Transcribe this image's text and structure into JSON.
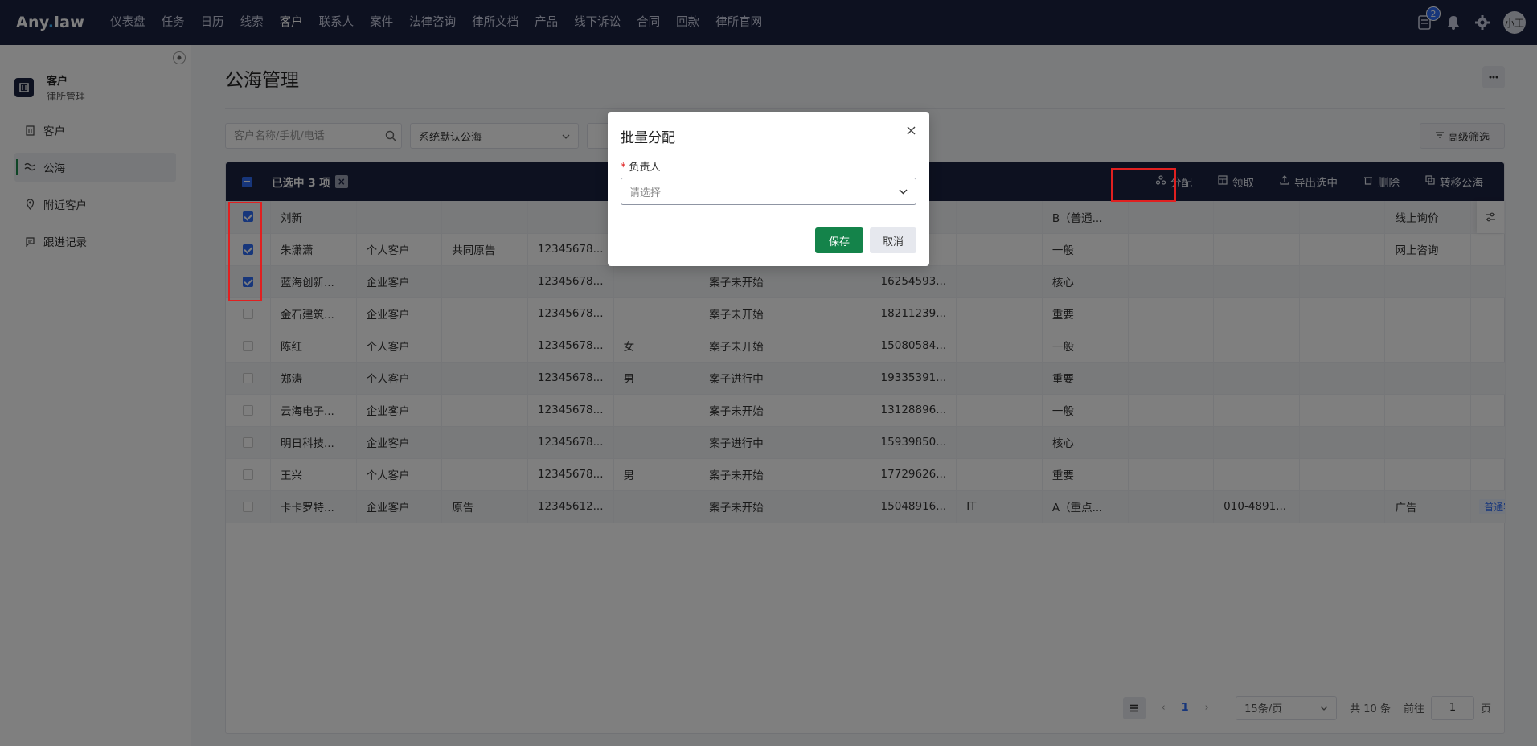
{
  "app": {
    "logo_main": "Any",
    "logo_dot": ".",
    "logo_suffix": "law",
    "nav": [
      "仪表盘",
      "任务",
      "日历",
      "线索",
      "客户",
      "联系人",
      "案件",
      "法律咨询",
      "律所文档",
      "产品",
      "线下诉讼",
      "合同",
      "回款",
      "律所官网"
    ],
    "active_nav": "客户",
    "notification_count": "2",
    "avatar_text": "小王"
  },
  "sidebar": {
    "title": "客户",
    "subtitle": "律所管理",
    "items": [
      {
        "label": "客户",
        "icon": "building-icon"
      },
      {
        "label": "公海",
        "icon": "waves-icon",
        "active": true
      },
      {
        "label": "附近客户",
        "icon": "map-pin-icon"
      },
      {
        "label": "跟进记录",
        "icon": "chat-icon"
      }
    ]
  },
  "page": {
    "title": "公海管理",
    "search_placeholder": "客户名称/手机/电话",
    "pool_select": "系统默认公海",
    "advanced_filter": "高级筛选"
  },
  "batch": {
    "selected_text": "已选中 3 项",
    "actions": [
      {
        "label": "分配",
        "icon": "users-icon"
      },
      {
        "label": "领取",
        "icon": "grid-icon"
      },
      {
        "label": "导出选中",
        "icon": "upload-icon"
      },
      {
        "label": "删除",
        "icon": "trash-icon"
      },
      {
        "label": "转移公海",
        "icon": "copy-icon"
      }
    ]
  },
  "table": {
    "rows": [
      {
        "checked": true,
        "cells": [
          "刘新",
          "",
          "",
          "",
          "",
          "",
          "",
          "",
          "",
          "B（普通...",
          "",
          "",
          "",
          "线上询价",
          ""
        ]
      },
      {
        "checked": true,
        "cells": [
          "朱潇潇",
          "个人客户",
          "共同原告",
          "12345678...",
          "",
          "",
          "",
          "",
          "",
          "一般",
          "",
          "",
          "",
          "网上咨询",
          ""
        ]
      },
      {
        "checked": true,
        "cells": [
          "蓝海创新...",
          "企业客户",
          "",
          "12345678...",
          "",
          "案子未开始",
          "",
          "16254593...",
          "",
          "核心",
          "",
          "",
          "",
          "",
          ""
        ]
      },
      {
        "checked": false,
        "cells": [
          "金石建筑...",
          "企业客户",
          "",
          "12345678...",
          "",
          "案子未开始",
          "",
          "18211239...",
          "",
          "重要",
          "",
          "",
          "",
          "",
          ""
        ]
      },
      {
        "checked": false,
        "cells": [
          "陈红",
          "个人客户",
          "",
          "12345678...",
          "女",
          "案子未开始",
          "",
          "15080584...",
          "",
          "一般",
          "",
          "",
          "",
          "",
          ""
        ]
      },
      {
        "checked": false,
        "cells": [
          "郑涛",
          "个人客户",
          "",
          "12345678...",
          "男",
          "案子进行中",
          "",
          "19335391...",
          "",
          "重要",
          "",
          "",
          "",
          "",
          ""
        ]
      },
      {
        "checked": false,
        "cells": [
          "云海电子...",
          "企业客户",
          "",
          "12345678...",
          "",
          "案子未开始",
          "",
          "13128896...",
          "",
          "一般",
          "",
          "",
          "",
          "",
          ""
        ]
      },
      {
        "checked": false,
        "cells": [
          "明日科技...",
          "企业客户",
          "",
          "12345678...",
          "",
          "案子进行中",
          "",
          "15939850...",
          "",
          "核心",
          "",
          "",
          "",
          "",
          ""
        ]
      },
      {
        "checked": false,
        "cells": [
          "王兴",
          "个人客户",
          "",
          "12345678...",
          "男",
          "案子未开始",
          "",
          "17729626...",
          "",
          "重要",
          "",
          "",
          "",
          "",
          ""
        ]
      },
      {
        "checked": false,
        "cells": [
          "卡卡罗特...",
          "企业客户",
          "原告",
          "12345612...",
          "",
          "案子未开始",
          "",
          "15048916...",
          "IT",
          "A（重点...",
          "",
          "010-4891...",
          "",
          "广告",
          ""
        ],
        "tag": "普通客户"
      }
    ]
  },
  "pager": {
    "prev": "‹",
    "page": "1",
    "next": "›",
    "page_size": "15条/页",
    "total": "共 10 条",
    "goto_label": "前往",
    "goto_value": "1",
    "page_unit": "页"
  },
  "modal": {
    "title": "批量分配",
    "required_mark": "*",
    "field_label": "负责人",
    "select_placeholder": "请选择",
    "save": "保存",
    "cancel": "取消"
  }
}
